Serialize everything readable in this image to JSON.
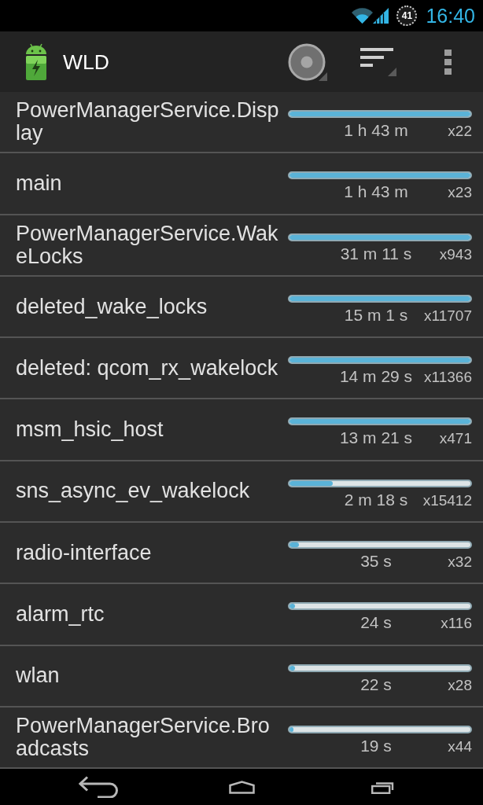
{
  "status_bar": {
    "battery_text": "41",
    "time": "16:40"
  },
  "action_bar": {
    "title": "WLD"
  },
  "wakelocks": [
    {
      "name": "PowerManagerService.Display",
      "level": 1,
      "duration": "1 h 43 m",
      "count": "x22"
    },
    {
      "name": "main",
      "level": 1,
      "duration": "1 h 43 m",
      "count": "x23"
    },
    {
      "name": "PowerManagerService.WakeLocks",
      "level": 1,
      "duration": "31 m 11 s",
      "count": "x943"
    },
    {
      "name": "deleted_wake_locks",
      "level": 1,
      "duration": "15 m 1 s",
      "count": "x11707"
    },
    {
      "name": "deleted: qcom_rx_wakelock",
      "level": 1,
      "duration": "14 m 29 s",
      "count": "x11366"
    },
    {
      "name": "msm_hsic_host",
      "level": 1,
      "duration": "13 m 21 s",
      "count": "x471"
    },
    {
      "name": "sns_async_ev_wakelock",
      "level": 0.24,
      "duration": "2 m 18 s",
      "count": "x15412"
    },
    {
      "name": "radio-interface",
      "level": 0.05,
      "duration": "35 s",
      "count": "x32"
    },
    {
      "name": "alarm_rtc",
      "level": 0.03,
      "duration": "24 s",
      "count": "x116"
    },
    {
      "name": "wlan",
      "level": 0.03,
      "duration": "22 s",
      "count": "x28"
    },
    {
      "name": "PowerManagerService.Broadcasts",
      "level": 0.02,
      "duration": "19 s",
      "count": "x44"
    }
  ]
}
